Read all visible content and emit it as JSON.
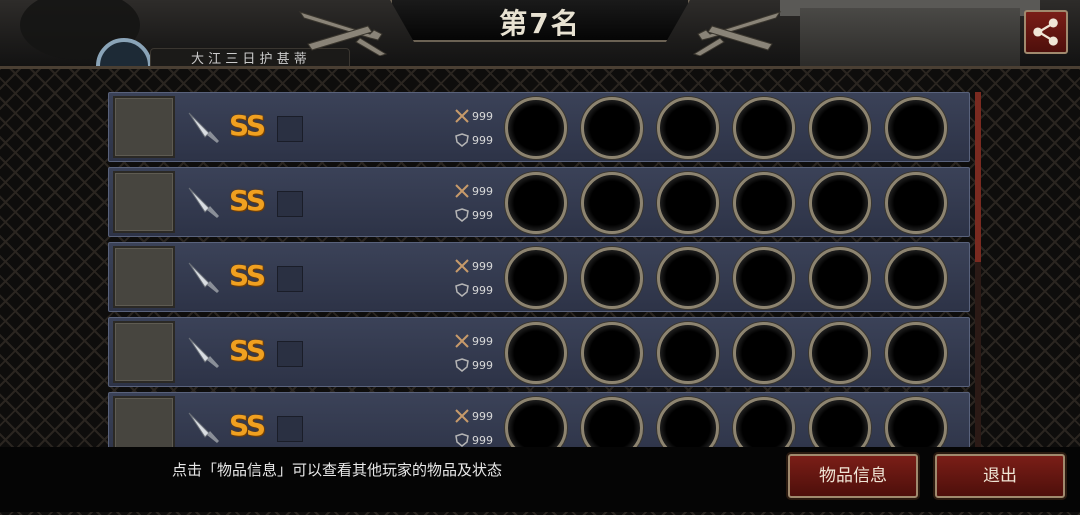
{
  "header": {
    "title": "第7名",
    "player_name": "大 江 三 日 护 甚 蒂",
    "share_icon": "share-icon"
  },
  "items": [
    {
      "weapon_icon": "knife-icon",
      "grade": "SS",
      "attack": "999",
      "defense": "999",
      "gem_slots": 6
    },
    {
      "weapon_icon": "knife-icon",
      "grade": "SS",
      "attack": "999",
      "defense": "999",
      "gem_slots": 6
    },
    {
      "weapon_icon": "knife-icon",
      "grade": "SS",
      "attack": "999",
      "defense": "999",
      "gem_slots": 6
    },
    {
      "weapon_icon": "knife-icon",
      "grade": "SS",
      "attack": "999",
      "defense": "999",
      "gem_slots": 6
    },
    {
      "weapon_icon": "knife-icon",
      "grade": "SS",
      "attack": "999",
      "defense": "999",
      "gem_slots": 6
    }
  ],
  "footer": {
    "hint": "点击「物品信息」可以查看其他玩家的物品及状态",
    "info_button": "物品信息",
    "exit_button": "退出"
  },
  "colors": {
    "grade": "#f0a020",
    "button": "#7a1e17",
    "row_bg": "#343a50"
  }
}
